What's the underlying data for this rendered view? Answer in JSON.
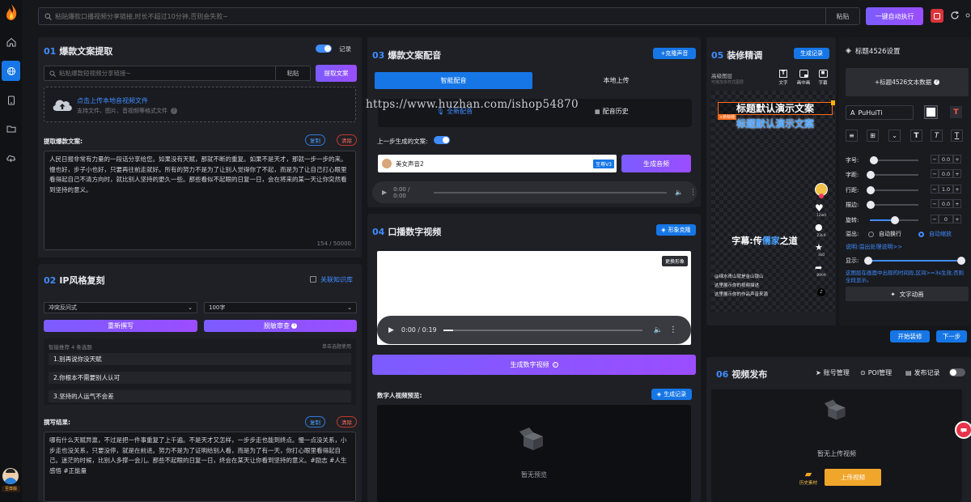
{
  "search": {
    "placeholder": "粘贴爆款口播视频分享链接,时长不超过10分钟,否则会失败~",
    "paste": "粘贴",
    "run": "一键自动执行"
  },
  "sidebar": {
    "user_label": "至尊版"
  },
  "p1": {
    "num": "01",
    "title": "爆款文案提取",
    "record": "记录",
    "link_placeholder": "粘贴爆款短视频分享链接~",
    "paste": "粘贴",
    "extract": "提取文案",
    "upload_title": "点击上传本地音视频文件",
    "upload_sub": "支持文件、图片、音视频等格式文件",
    "label": "提取爆款文案:",
    "copy": "复制",
    "clear": "清除",
    "text": "人民日报非常有力量的一段话分享给您。如果没有天赋，那就不断的重复。如果不是天才，那就一步一步的来。慢也好，步子小也好，只要再往前走就好。所有的努力不是为了让别人觉得你了不起，而是为了让自己打心眼里看得起自己不清方向时，就比别人坚持的更久一些。那些看似不起眼的日复一日，会在将来的某一天让你突然看到坚持的意义。",
    "count": "154 / 50000"
  },
  "p2": {
    "num": "02",
    "title": "IP风格复刻",
    "kb": "关联知识库",
    "sel1": "冲突反问式",
    "sel2": "100字",
    "rewrite": "重新撰写",
    "review": "脱敏审查",
    "rec_label": "智能推荐 4 条选题",
    "rec_hint": "单击选题使用",
    "items": [
      "1.别再说你没天赋",
      "2.你根本不需要别人认可",
      "3.坚持的人运气不会差"
    ],
    "result_label": "撰写结果:",
    "copy": "复制",
    "clear": "清除",
    "result": "哪有什么天赋异禀，不过是把一件事重复了上千遍。不是天才又怎样，一步步走也能到终点。慢一点没关系，小步走也没关系，只要没停，就是在前进。努力不是为了证明给别人看，而是为了有一天，你打心眼里看得起自己。迷茫的时候，比别人多撑一会儿。那些不起眼的日复一日，终会在某天让你看到坚持的意义。#励志 #人生感悟 #正能量"
  },
  "p3": {
    "num": "03",
    "title": "爆款文案配音",
    "clone": "+克隆声音",
    "tab1": "智能配音",
    "tab2": "本地上传",
    "newvoice": "全新配音",
    "history": "配音历史",
    "prev_label": "上一步生成的文案:",
    "voice": "美女声音2",
    "voice_tag": "至尊V3",
    "gen": "生成音频",
    "time": "0:00 / 0:00"
  },
  "watermark": "https://www.huzhan.com/ishop54870",
  "p4": {
    "num": "04",
    "title": "口播数字视频",
    "clone": "形象克隆",
    "change": "更换形象",
    "time": "0:00 / 0:19",
    "gen": "生成数字视频",
    "preview_label": "数字人视频预览:",
    "record": "生成记录",
    "empty": "暂无预览"
  },
  "p5": {
    "num": "05",
    "title": "装修精调",
    "record": "生成记录",
    "layer_label": "高级图层",
    "layer_sub": "可拖加多样式图层",
    "tools": [
      "文字",
      "画中画",
      "字幕"
    ],
    "headline1": "标题默认演示文案",
    "headline2": "标题默认演示文案",
    "tag": "+新标题",
    "subtitle_a": "字幕:传",
    "subtitle_b": "儒家",
    "subtitle_c": "之道",
    "desc1": "@绿水青山就是金山银山",
    "desc2": "这里展示你的视频描述",
    "desc3": "这里展示你的作品声音来源",
    "counts": [
      "12w0",
      "23k9",
      "3k0",
      "8909"
    ],
    "start": "开始装修",
    "next": "下一步"
  },
  "settings": {
    "title": "标题4526设置",
    "data_btn": "+标题4526文本数据",
    "font": "PuHuiTi",
    "rows": [
      {
        "label": "字号:",
        "value": "0.0",
        "pct": 0.06
      },
      {
        "label": "字距:",
        "value": "0.0",
        "pct": 0.0
      },
      {
        "label": "行距:",
        "value": "1.0",
        "pct": 0.0
      },
      {
        "label": "描边:",
        "value": "0.0",
        "pct": 0.0
      },
      {
        "label": "旋转:",
        "value": "0",
        "pct": 0.5
      }
    ],
    "overflow": "溢出:",
    "wrap": "自动换行",
    "shrink": "自动缩放",
    "help": "说明:溢出处理说明>>",
    "show": "显示:",
    "show_desc": "这图层在画面中出现的时间段,区间>=3s生效,否则全段显示。",
    "anim": "文字动画"
  },
  "p6": {
    "num": "06",
    "title": "视频发布",
    "account": "账号管理",
    "poi": "POI管理",
    "log": "发布记录",
    "empty": "暂无上传视频",
    "history": "历史素材",
    "upload": "上传视频"
  },
  "colors": {
    "accent": "#3f8cff",
    "violet": "#8456ff",
    "blue": "#1676e6"
  }
}
